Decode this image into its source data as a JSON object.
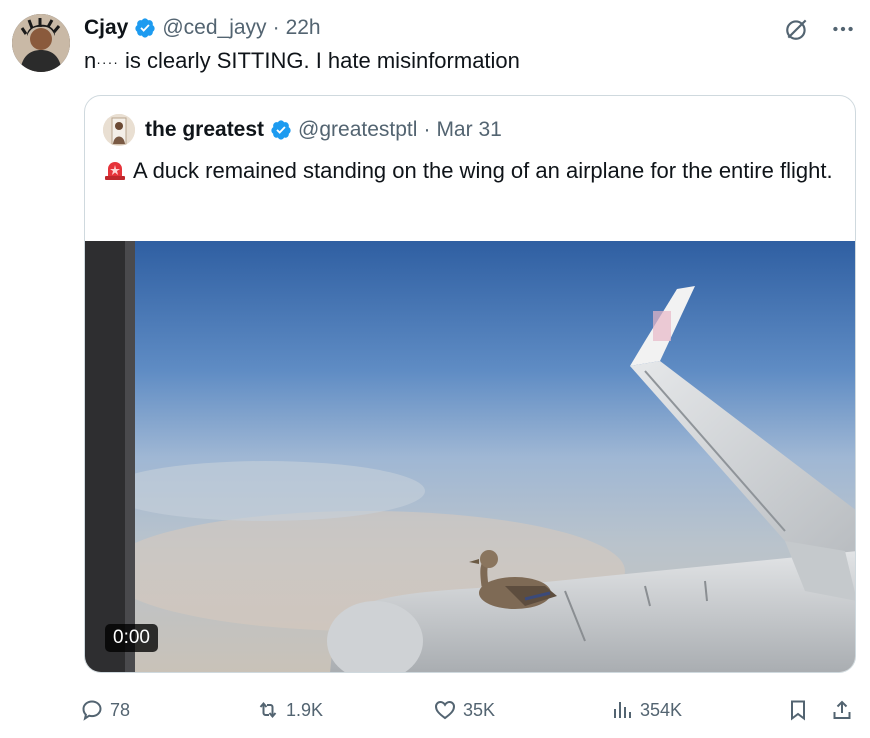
{
  "author": {
    "name": "Cjay",
    "handle": "@ced_jayy",
    "separator": "·",
    "time": "22h"
  },
  "tweet": {
    "text_prefix": "n",
    "text_dots": "····",
    "text_main": " is clearly SITTING. I hate misinformation"
  },
  "quoted": {
    "name": "the greatest",
    "handle": "@greatestptl",
    "separator": "·",
    "date": "Mar 31",
    "text": "A duck remained standing on the wing of an airplane for the entire flight.",
    "video_time": "0:00"
  },
  "actions": {
    "replies": "78",
    "reposts": "1.9K",
    "likes": "35K",
    "views": "354K"
  },
  "colors": {
    "verified": "#1d9bf0",
    "muted": "#536471",
    "border": "#cfd9de"
  },
  "icons": [
    "verified-badge-icon",
    "grok-icon",
    "more-icon",
    "siren-icon",
    "reply-icon",
    "repost-icon",
    "like-icon",
    "views-icon",
    "bookmark-icon",
    "share-icon"
  ]
}
